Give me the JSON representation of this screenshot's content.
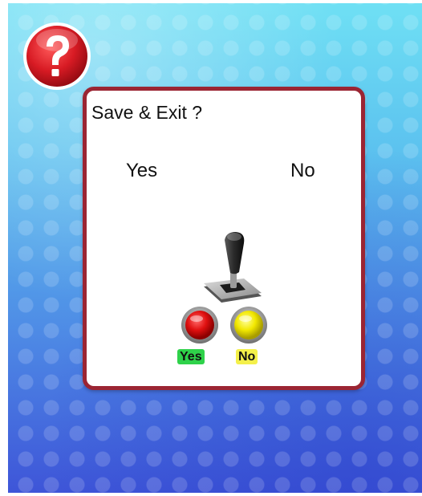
{
  "dialog": {
    "title": "Save & Exit ?",
    "option_yes": "Yes",
    "option_no": "No"
  },
  "controls": {
    "red_button_label": "Yes",
    "yellow_button_label": "No"
  },
  "icons": {
    "help": "question-mark-icon",
    "joystick": "joystick-icon"
  },
  "colors": {
    "dialog_border": "#9b2533",
    "help_icon": "#e0202a",
    "yes_tag": "#2fd24a",
    "no_tag": "#f4f04a"
  }
}
